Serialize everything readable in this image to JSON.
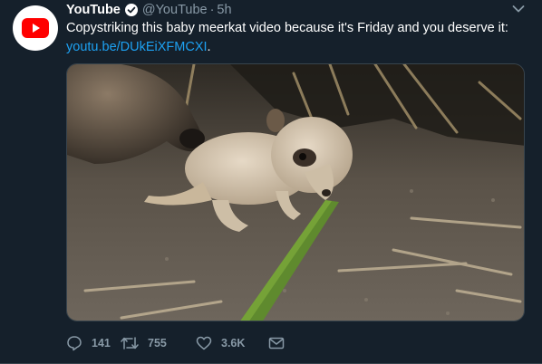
{
  "tweet": {
    "author_name": "YouTube",
    "handle": "@YouTube",
    "separator": "·",
    "time": "5h",
    "text_line1": "Copystriking this baby meerkat video because it's Friday and you deserve it:",
    "link_text": "youtu.be/DUkEiXFMCXI",
    "link_suffix": "."
  },
  "media": {
    "description_icon": "video-thumbnail"
  },
  "actions": {
    "reply_count": "141",
    "retweet_count": "755",
    "like_count": "3.6K"
  },
  "icons": {
    "avatar": "youtube-logo-icon",
    "verified": "verified-badge-icon",
    "menu": "chevron-down-icon",
    "reply": "reply-icon",
    "retweet": "retweet-icon",
    "like": "heart-icon",
    "dm": "envelope-icon"
  },
  "colors": {
    "background": "#15202b",
    "accent": "#1da1f2",
    "muted": "#8899a6",
    "youtube_red": "#ff0000"
  }
}
